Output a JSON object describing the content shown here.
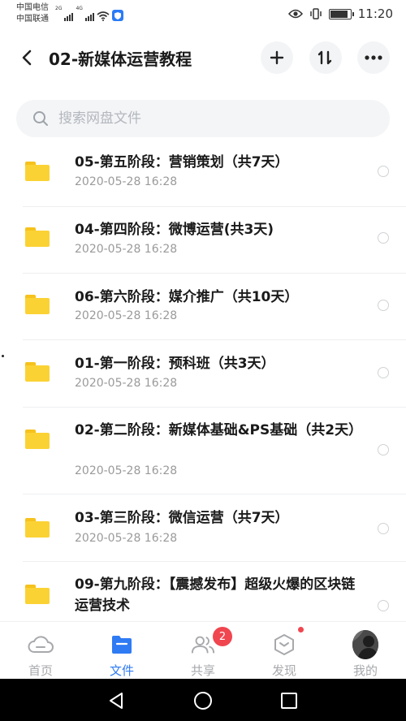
{
  "status_bar": {
    "carrier_1": "中国电信",
    "carrier_2": "中国联通",
    "net_1": "2G",
    "net_2": "4G",
    "time": "11:20",
    "battery_level": 0.9
  },
  "header": {
    "title": "02-新媒体运营教程",
    "back_icon": "chevron-left-icon",
    "add_icon": "plus-icon",
    "sort_icon": "sort-icon",
    "more_icon": "more-icon"
  },
  "search": {
    "placeholder": "搜索网盘文件",
    "value": ""
  },
  "files": [
    {
      "name": "05-第五阶段：营销策划（共7天）",
      "date": "2020-05-28  16:28"
    },
    {
      "name": "04-第四阶段：微博运营(共3天)",
      "date": "2020-05-28  16:28"
    },
    {
      "name": "06-第六阶段：媒介推广（共10天）",
      "date": "2020-05-28  16:28"
    },
    {
      "name": "01-第一阶段：预科班（共3天）",
      "date": "2020-05-28  16:28"
    },
    {
      "name": "02-第二阶段：新媒体基础&PS基础（共2天）",
      "date": "2020-05-28  16:28"
    },
    {
      "name": "03-第三阶段：微信运营（共7天）",
      "date": "2020-05-28  16:28"
    },
    {
      "name": "09-第九阶段：【震撼发布】超级火爆的区块链运营技术",
      "date": ""
    }
  ],
  "tabs": [
    {
      "label": "首页",
      "icon": "cloud-icon"
    },
    {
      "label": "文件",
      "icon": "folder-icon"
    },
    {
      "label": "共享",
      "icon": "people-icon"
    },
    {
      "label": "发现",
      "icon": "discover-icon"
    },
    {
      "label": "我的",
      "icon": "avatar"
    }
  ],
  "share_badge": "2",
  "colors": {
    "accent": "#2f7bf4",
    "folder": "#fbd234",
    "badge": "#f0464f"
  }
}
